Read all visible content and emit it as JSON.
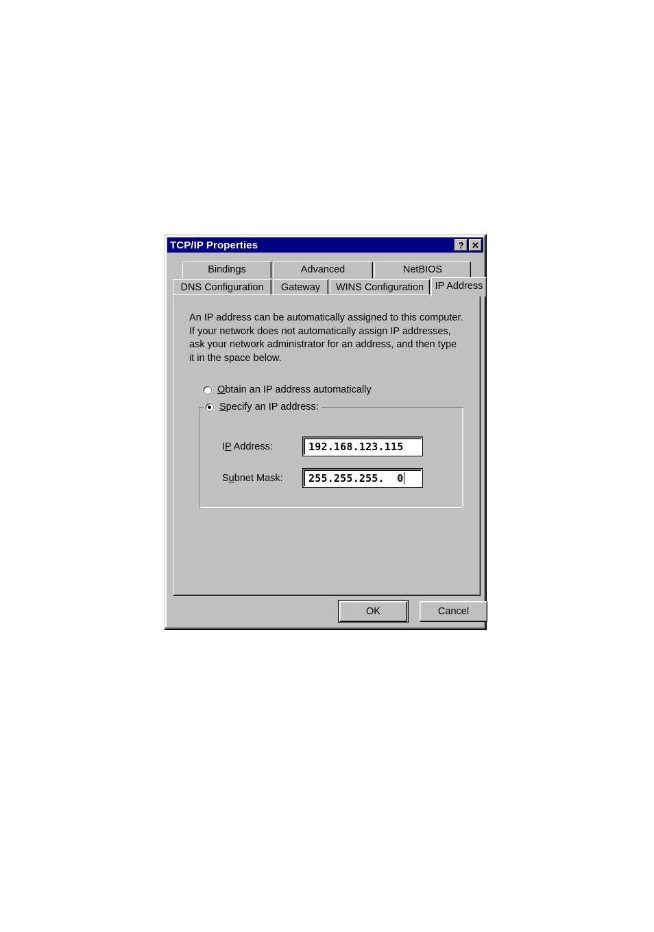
{
  "window": {
    "title": "TCP/IP Properties",
    "help_button": "?",
    "close_button": "✕"
  },
  "tabs": {
    "row_top": [
      {
        "label": "Bindings",
        "active": false
      },
      {
        "label": "Advanced",
        "active": false
      },
      {
        "label": "NetBIOS",
        "active": false
      }
    ],
    "row_bottom": [
      {
        "label": "DNS Configuration",
        "active": false
      },
      {
        "label": "Gateway",
        "active": false
      },
      {
        "label": "WINS Configuration",
        "active": false
      },
      {
        "label": "IP Address",
        "active": true
      }
    ]
  },
  "panel": {
    "description": "An IP address can be automatically assigned to this computer. If your network does not automatically assign IP addresses, ask your network administrator for an address, and then type it in the space below.",
    "options": {
      "obtain": {
        "accel": "O",
        "label_rest": "btain an IP address automatically",
        "checked": false
      },
      "specify": {
        "accel": "S",
        "label_rest": "pecify an IP address:",
        "checked": true
      }
    },
    "fields": [
      {
        "label_pre": "I",
        "label_accel": "P",
        "label_post": " Address:",
        "value": "192.168.123.115",
        "has_caret": false
      },
      {
        "label_pre": "S",
        "label_accel": "u",
        "label_post": "bnet Mask:",
        "value": "255.255.255.  0",
        "has_caret": true
      }
    ]
  },
  "buttons": {
    "ok": "OK",
    "cancel": "Cancel"
  },
  "colors": {
    "titlebar": "#000080",
    "dialog_face": "#c0c0c0",
    "field_background": "#ffffff",
    "text": "#000000",
    "title_text": "#ffffff",
    "shadow": "#808080"
  }
}
